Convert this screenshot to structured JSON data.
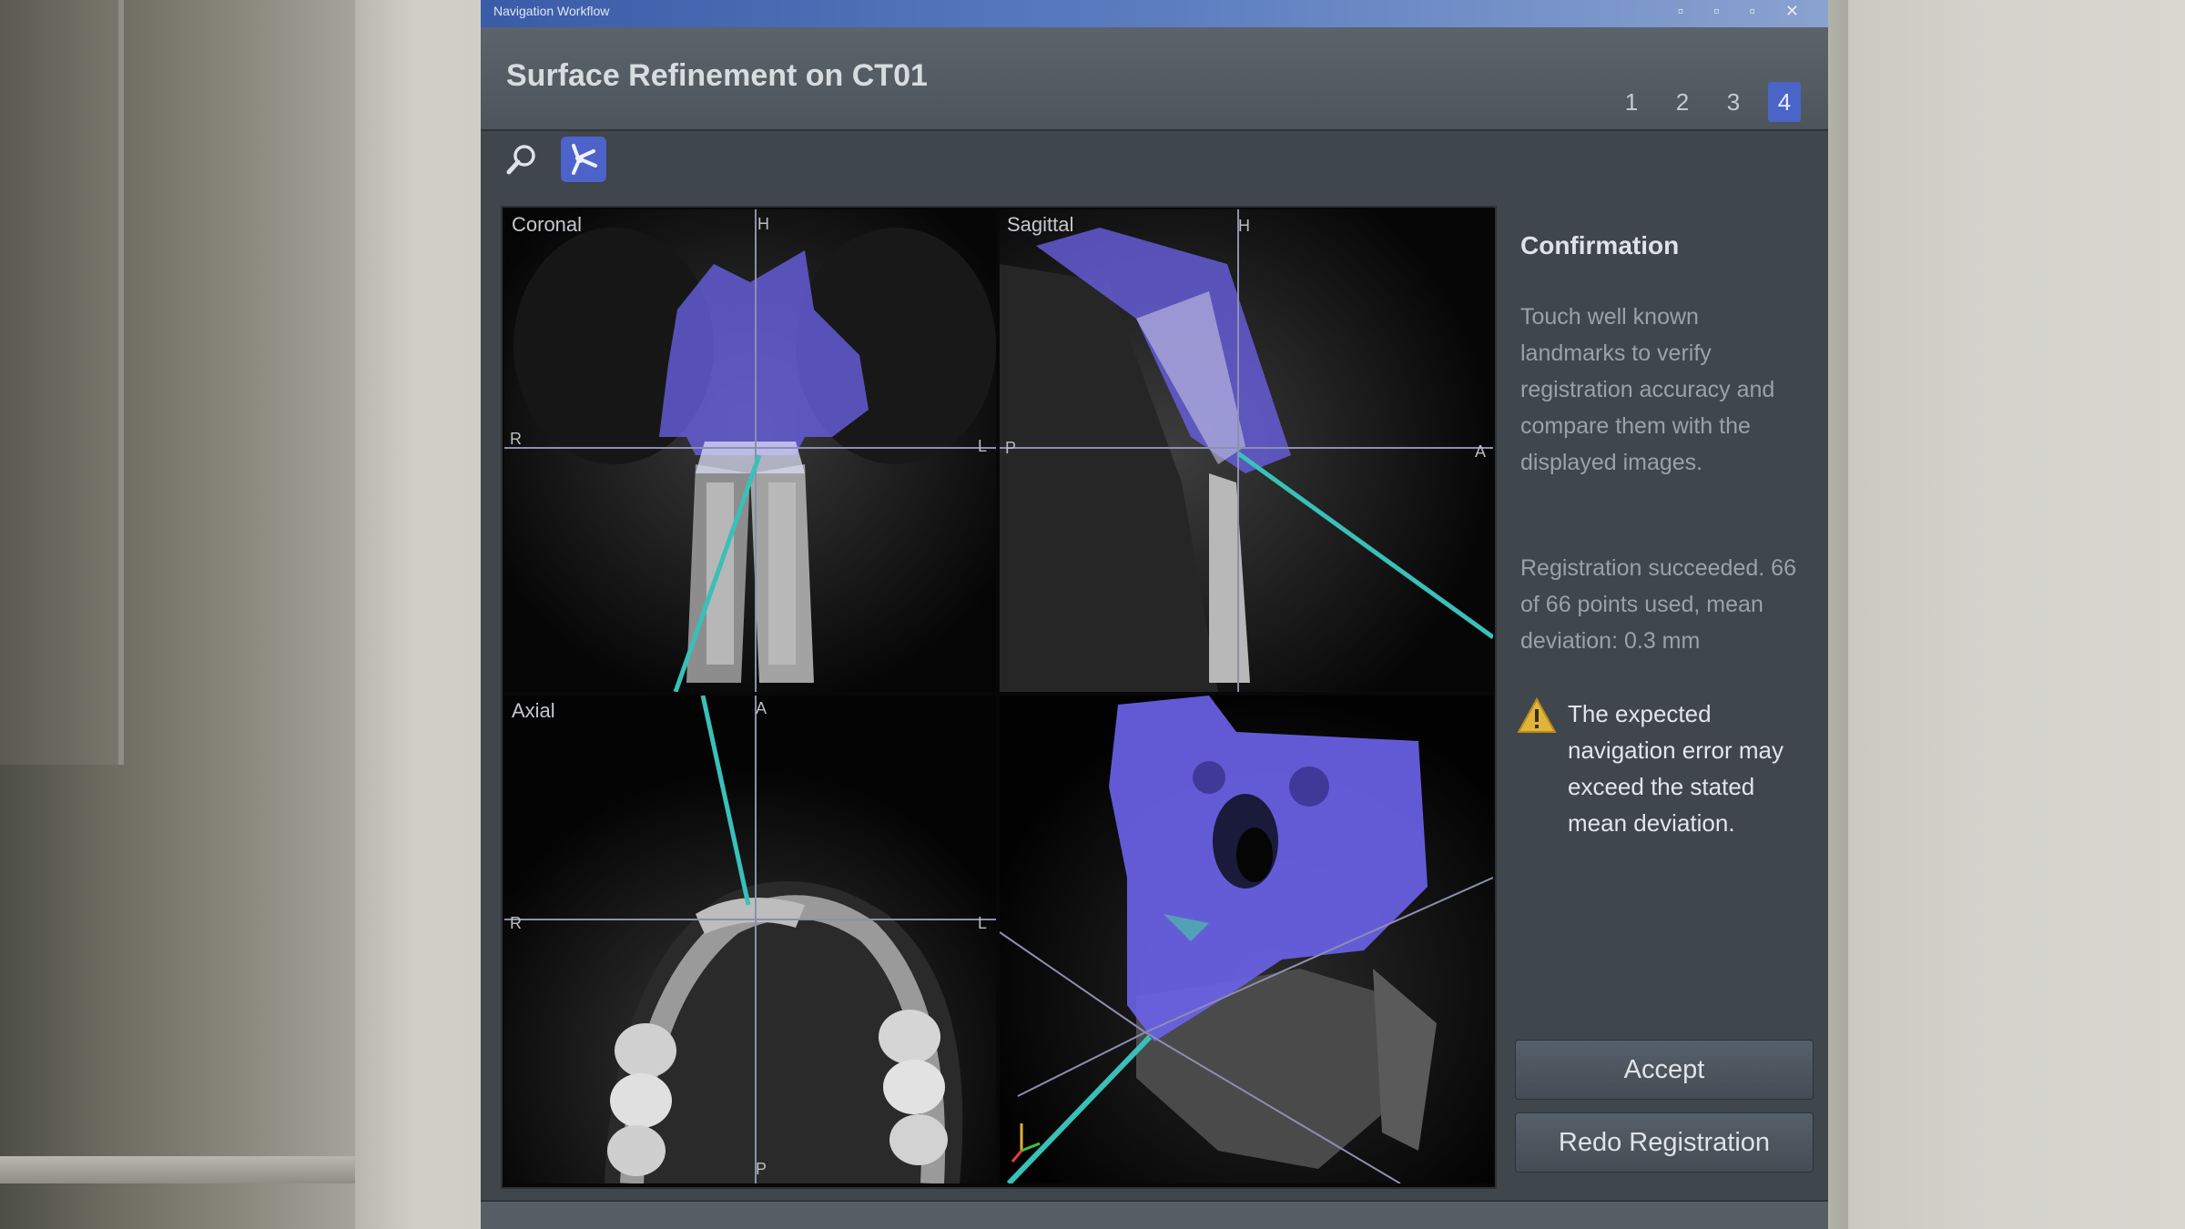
{
  "window": {
    "bar_title": "Navigation Workflow",
    "controls": "▫ ▫ ▫ ✕"
  },
  "header": {
    "title": "Surface Refinement on CT01",
    "steps": [
      {
        "label": "1"
      },
      {
        "label": "2"
      },
      {
        "label": "3"
      },
      {
        "label": "4"
      }
    ],
    "active_step": "4"
  },
  "toolbar": {
    "tools": [
      {
        "icon": "magnifier-icon",
        "active": false
      },
      {
        "icon": "pointer-tool-icon",
        "active": true
      }
    ]
  },
  "viewports": {
    "coronal": {
      "label": "Coronal",
      "top": "H",
      "left": "R",
      "right": "L"
    },
    "sagittal": {
      "label": "Sagittal",
      "top": "H",
      "left": "P",
      "right": "A"
    },
    "axial": {
      "label": "Axial",
      "top": "A",
      "left": "R",
      "right": "L",
      "bottom": "P"
    },
    "render3d": {
      "label": ""
    }
  },
  "panel": {
    "title": "Confirmation",
    "instructions": "Touch well known landmarks to verify registration accuracy and compare them with the displayed images.",
    "result": "Registration succeeded. 66 of 66 points used, mean deviation: 0.3 mm",
    "warning": "The expected navigation error may exceed the stated mean deviation.",
    "accept_label": "Accept",
    "redo_label": "Redo Registration"
  },
  "colors": {
    "overlay": "#6a62e6",
    "pointer_line": "#39c0b8",
    "accent": "#4a64c8",
    "warning": "#e2b43a"
  }
}
